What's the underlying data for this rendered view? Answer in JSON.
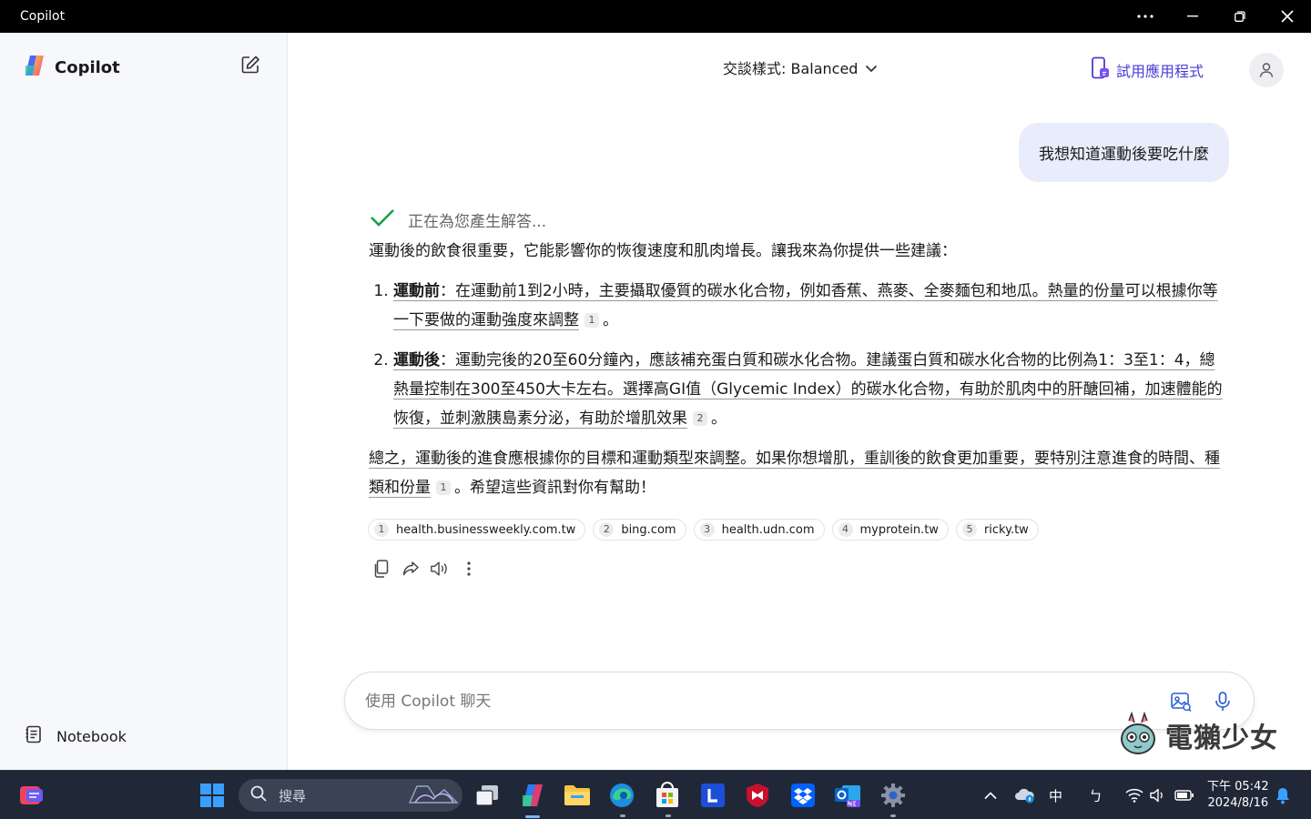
{
  "window": {
    "title": "Copilot"
  },
  "sidebar": {
    "brand": "Copilot",
    "notebook_label": "Notebook"
  },
  "header": {
    "mode_label": "交談樣式: Balanced",
    "try_app_label": "試用應用程式"
  },
  "chat": {
    "user_message": "我想知道運動後要吃什麼",
    "status_text": "正在為您產生解答...",
    "intro": "運動後的飲食很重要，它能影響你的恢復速度和肌肉增長。讓我來為你提供一些建議：",
    "items": [
      {
        "term": "運動前",
        "text": "：在運動前1到2小時，主要攝取優質的碳水化合物，例如香蕉、燕麥、全麥麵包和地瓜。熱量的份量可以根據你等一下要做的運動強度來調整",
        "cite": "1",
        "end": "。"
      },
      {
        "term": "運動後",
        "text": "：運動完後的20至60分鐘內，應該補充蛋白質和碳水化合物。建議蛋白質和碳水化合物的比例為1：3至1：4，總熱量控制在300至450大卡左右。選擇高GI值（Glycemic Index）的碳水化合物，有助於肌肉中的肝醣回補，加速體能的恢復，並刺激胰島素分泌，有助於增肌效果",
        "cite": "2",
        "end": "。"
      }
    ],
    "summary": "總之，運動後的進食應根據你的目標和運動類型來調整。如果你想增肌，重訓後的飲食更加重要，要特別注意進食的時間、種類和份量",
    "summary_cite": "1",
    "summary_end": "。希望這些資訊對你有幫助！",
    "sources": [
      {
        "num": "1",
        "label": "health.businessweekly.com.tw"
      },
      {
        "num": "2",
        "label": "bing.com"
      },
      {
        "num": "3",
        "label": "health.udn.com"
      },
      {
        "num": "4",
        "label": "myprotein.tw"
      },
      {
        "num": "5",
        "label": "ricky.tw"
      }
    ]
  },
  "composer": {
    "placeholder": "使用 Copilot 聊天"
  },
  "watermark": {
    "text": "電獺少女"
  },
  "taskbar": {
    "search_label": "搜尋",
    "ime_label": "中",
    "ime_mode": "ㄅ",
    "time": "下午 05:42",
    "date": "2024/8/16"
  },
  "colors": {
    "accent": "#4b3bd6",
    "check": "#1a9e4b",
    "taskbar_bg": "#202838"
  }
}
